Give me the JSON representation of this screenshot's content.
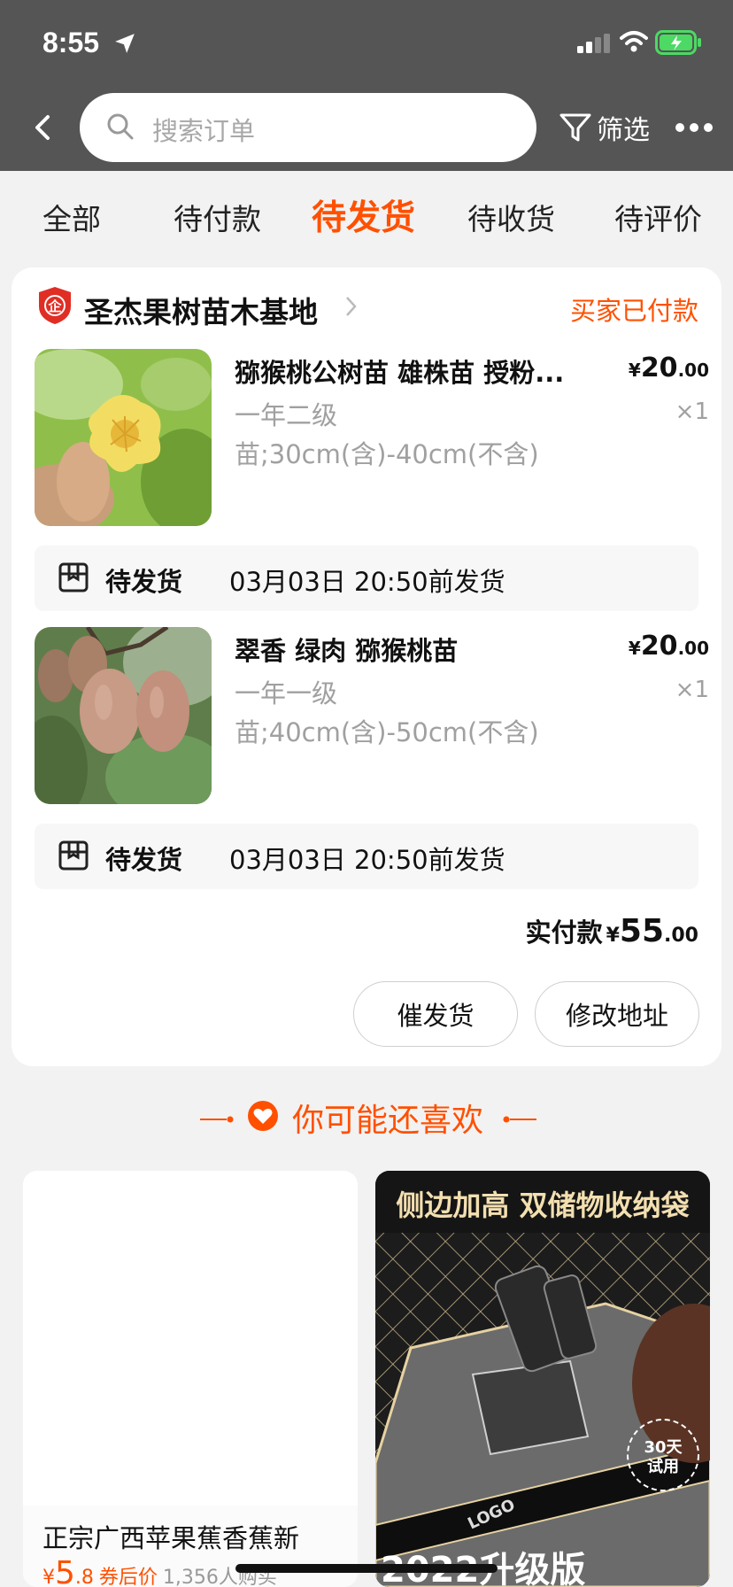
{
  "status_bar": {
    "time": "8:55"
  },
  "header": {
    "search_placeholder": "搜索订单",
    "filter_label": "筛选"
  },
  "tabs": [
    {
      "label": "全部",
      "active": false
    },
    {
      "label": "待付款",
      "active": false
    },
    {
      "label": "待发货",
      "active": true
    },
    {
      "label": "待收货",
      "active": false
    },
    {
      "label": "待评价",
      "active": false
    }
  ],
  "order": {
    "shop_badge": "企",
    "shop_name": "圣杰果树苗木基地",
    "status": "买家已付款",
    "items": [
      {
        "title": "猕猴桃公树苗 雄株苗 授粉...",
        "spec_line1": "一年二级",
        "spec_line2": "苗;30cm(含)-40cm(不含)",
        "price_currency": "¥",
        "price_int": "20",
        "price_dec": ".00",
        "qty": "×1",
        "ship_label": "待发货",
        "ship_time": "03月03日 20:50前发货"
      },
      {
        "title": "翠香 绿肉 猕猴桃苗",
        "spec_line1": "一年一级",
        "spec_line2": "苗;40cm(含)-50cm(不含)",
        "price_currency": "¥",
        "price_int": "20",
        "price_dec": ".00",
        "qty": "×1",
        "ship_label": "待发货",
        "ship_time": "03月03日 20:50前发货"
      }
    ],
    "total_label": "实付款",
    "total_currency": "¥",
    "total_int": "55",
    "total_dec": ".00",
    "buttons": {
      "urge": "催发货",
      "modify_address": "修改地址"
    }
  },
  "recommend": {
    "title": "你可能还喜欢",
    "left": {
      "name": "正宗广西苹果蕉香蕉新",
      "currency": "¥",
      "price_int": "5",
      "price_dec": ".8",
      "price_tag": "券后价",
      "sold": "1,356人购买"
    },
    "right": {
      "banner": "侧边加高 双储物收纳袋",
      "badge_line1": "30天",
      "badge_line2": "试用",
      "mat_logo": "LOGO",
      "bottom_text": "2022升级版"
    }
  },
  "colors": {
    "accent": "#ff5000",
    "topbar": "#555555",
    "background": "#f2f2f2"
  }
}
